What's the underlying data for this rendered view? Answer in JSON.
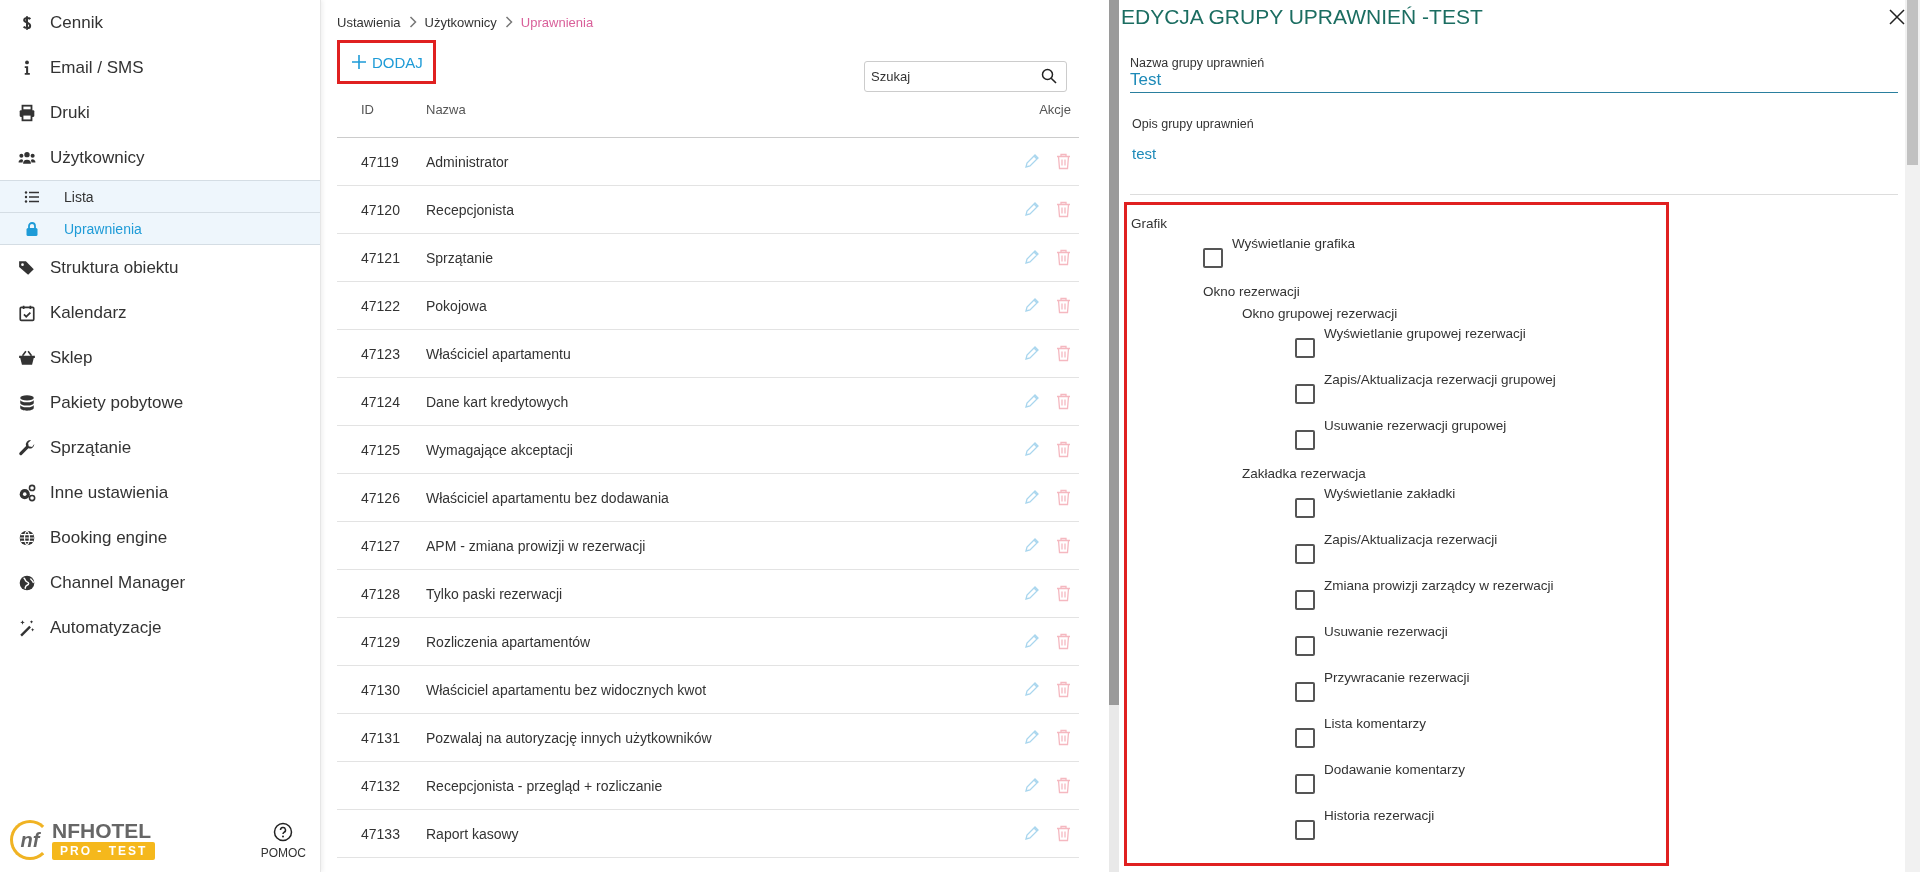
{
  "sidebar": {
    "items": [
      {
        "label": "Cennik",
        "selected": false
      },
      {
        "label": "Email / SMS",
        "selected": false
      },
      {
        "label": "Druki",
        "selected": false
      },
      {
        "label": "Użytkownicy",
        "selected": false,
        "children": [
          {
            "label": "Lista",
            "selected": false
          },
          {
            "label": "Uprawnienia",
            "selected": true
          }
        ]
      },
      {
        "label": "Struktura obiektu",
        "selected": false
      },
      {
        "label": "Kalendarz",
        "selected": false
      },
      {
        "label": "Sklep",
        "selected": false
      },
      {
        "label": "Pakiety pobytowe",
        "selected": false
      },
      {
        "label": "Sprzątanie",
        "selected": false
      },
      {
        "label": "Inne ustawienia",
        "selected": false
      },
      {
        "label": "Booking engine",
        "selected": false
      },
      {
        "label": "Channel Manager",
        "selected": false
      },
      {
        "label": "Automatyzacje",
        "selected": false
      }
    ],
    "logo": {
      "mark": "nf",
      "name": "NFHOTEL",
      "badge": "PRO - TEST"
    },
    "help": "POMOC"
  },
  "breadcrumb": [
    "Ustawienia",
    "Użytkownicy",
    "Uprawnienia"
  ],
  "add_button": "DODAJ",
  "search": {
    "placeholder": "Szukaj"
  },
  "table": {
    "columns": [
      "ID",
      "Nazwa",
      "Akcje"
    ],
    "rows": [
      {
        "id": "47119",
        "name": "Administrator"
      },
      {
        "id": "47120",
        "name": "Recepcjonista"
      },
      {
        "id": "47121",
        "name": "Sprzątanie"
      },
      {
        "id": "47122",
        "name": "Pokojowa"
      },
      {
        "id": "47123",
        "name": "Właściciel apartamentu"
      },
      {
        "id": "47124",
        "name": "Dane kart kredytowych"
      },
      {
        "id": "47125",
        "name": "Wymagające akceptacji"
      },
      {
        "id": "47126",
        "name": "Właściciel apartamentu bez dodawania"
      },
      {
        "id": "47127",
        "name": "APM - zmiana prowizji w rezerwacji"
      },
      {
        "id": "47128",
        "name": "Tylko paski rezerwacji"
      },
      {
        "id": "47129",
        "name": "Rozliczenia apartamentów"
      },
      {
        "id": "47130",
        "name": "Właściciel apartamentu bez widocznych kwot"
      },
      {
        "id": "47131",
        "name": "Pozwalaj na autoryzację innych użytkowników"
      },
      {
        "id": "47132",
        "name": "Recepcjonista - przegląd + rozliczanie"
      },
      {
        "id": "47133",
        "name": "Raport kasowy"
      }
    ]
  },
  "edit_panel": {
    "title": "EDYCJA GRUPY UPRAWNIEŃ -TEST",
    "name_field": {
      "label": "Nazwa grupy uprawnień",
      "value": "Test"
    },
    "description_field": {
      "label": "Opis grupy uprawnień",
      "value": "test"
    },
    "permissions": [
      {
        "kind": "group",
        "label": "Grafik",
        "children": [
          {
            "kind": "checkbox",
            "label": "Wyświetlanie grafika",
            "checked": false
          },
          {
            "kind": "group",
            "label": "Okno rezerwacji",
            "children": [
              {
                "kind": "group",
                "label": "Okno grupowej rezerwacji",
                "children": [
                  {
                    "kind": "checkbox",
                    "label": "Wyświetlanie grupowej rezerwacji",
                    "checked": false
                  },
                  {
                    "kind": "checkbox",
                    "label": "Zapis/Aktualizacja rezerwacji grupowej",
                    "checked": false
                  },
                  {
                    "kind": "checkbox",
                    "label": "Usuwanie rezerwacji grupowej",
                    "checked": false
                  }
                ]
              },
              {
                "kind": "group",
                "label": "Zakładka rezerwacja",
                "children": [
                  {
                    "kind": "checkbox",
                    "label": "Wyświetlanie zakładki",
                    "checked": false
                  },
                  {
                    "kind": "checkbox",
                    "label": "Zapis/Aktualizacja rezerwacji",
                    "checked": false
                  },
                  {
                    "kind": "checkbox",
                    "label": "Zmiana prowizji zarządcy w rezerwacji",
                    "checked": false
                  },
                  {
                    "kind": "checkbox",
                    "label": "Usuwanie rezerwacji",
                    "checked": false
                  },
                  {
                    "kind": "checkbox",
                    "label": "Przywracanie rezerwacji",
                    "checked": false
                  },
                  {
                    "kind": "checkbox",
                    "label": "Lista komentarzy",
                    "checked": false
                  },
                  {
                    "kind": "checkbox",
                    "label": "Dodawanie komentarzy",
                    "checked": false
                  },
                  {
                    "kind": "checkbox",
                    "label": "Historia rezerwacji",
                    "checked": false
                  }
                ]
              }
            ]
          }
        ]
      }
    ]
  }
}
